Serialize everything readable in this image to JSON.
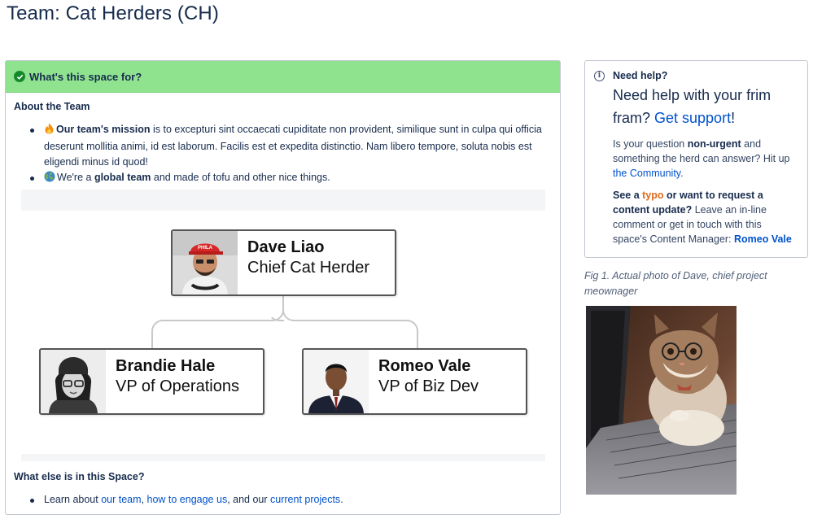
{
  "page": {
    "title": "Team: Cat Herders (CH)"
  },
  "panel": {
    "header": "What's this space for?",
    "about_title": "About the Team",
    "bullets": {
      "mission_bold": "Our team's mission",
      "mission_text": " is to excepturi sint occaecati cupiditate non provident, similique sunt in culpa qui officia deserunt mollitia animi, id est laborum. Facilis est et expedita distinctio. Nam libero tempore, soluta nobis est eligendi minus id quod!",
      "global_pre": "We're a ",
      "global_bold": "global team",
      "global_post": " and made of tofu and other nice things."
    },
    "else_title": "What else is in this Space?",
    "else_item": {
      "pre": "Learn about ",
      "link1": "our team",
      "sep1": ", ",
      "link2": "how to engage us",
      "sep2": ", and our ",
      "link3": "current projects",
      "post": "."
    }
  },
  "org_chart": {
    "root": {
      "name": "Dave Liao",
      "role": "Chief Cat Herder",
      "cap_text": "PHILA"
    },
    "children": [
      {
        "name": "Brandie Hale",
        "role": "VP of Operations"
      },
      {
        "name": "Romeo Vale",
        "role": "VP of Biz Dev"
      }
    ]
  },
  "help": {
    "heading": "Need help?",
    "big_pre": "Need help with your frim fram? ",
    "big_link": "Get support",
    "big_post": "!",
    "p1_pre": "Is your question ",
    "p1_bold": "non-urgent",
    "p1_mid": " and something the herd can answer? Hit up ",
    "p1_link": "the Community",
    "p1_post": ".",
    "p2_bold1": "See a ",
    "p2_typo": "typo",
    "p2_bold2": " or want to request a content update?",
    "p2_text": " Leave an in-line comment or get in touch with this space's Content Manager: ",
    "p2_link": "Romeo Vale"
  },
  "figure": {
    "caption": "Fig 1. Actual photo of Dave, chief project meownager"
  },
  "colors": {
    "accent_green": "#8fe38f",
    "link": "#0052cc",
    "typo_orange": "#de6a19"
  }
}
